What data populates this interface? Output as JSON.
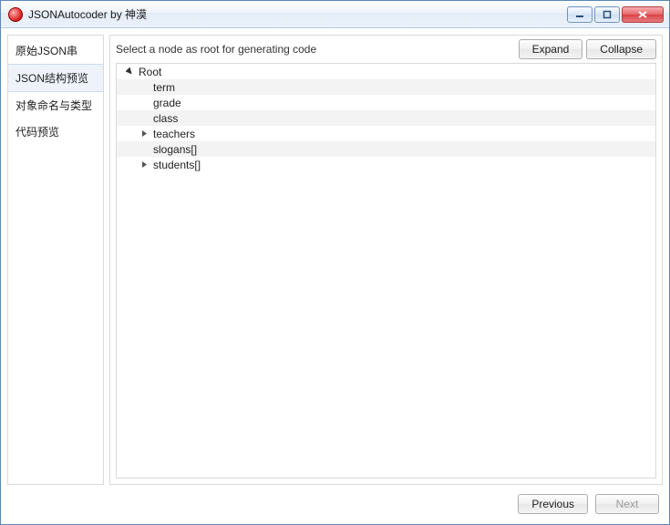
{
  "window": {
    "title": "JSONAutocoder by 神漠"
  },
  "sidebar": {
    "items": [
      {
        "label": "原始JSON串",
        "selected": false
      },
      {
        "label": "JSON结构预览",
        "selected": true
      },
      {
        "label": "对象命名与类型",
        "selected": false
      },
      {
        "label": "代码预览",
        "selected": false
      }
    ]
  },
  "header": {
    "hint": "Select a node as root for generating code",
    "expand_label": "Expand",
    "collapse_label": "Collapse"
  },
  "tree": {
    "rows": [
      {
        "label": "Root",
        "depth": 0,
        "toggle": "open",
        "alt": false
      },
      {
        "label": "term",
        "depth": 1,
        "toggle": "none",
        "alt": true
      },
      {
        "label": "grade",
        "depth": 1,
        "toggle": "none",
        "alt": false
      },
      {
        "label": "class",
        "depth": 1,
        "toggle": "none",
        "alt": true
      },
      {
        "label": "teachers",
        "depth": 1,
        "toggle": "closed",
        "alt": false
      },
      {
        "label": "slogans[]",
        "depth": 1,
        "toggle": "none",
        "alt": true
      },
      {
        "label": "students[]",
        "depth": 1,
        "toggle": "closed",
        "alt": false
      }
    ]
  },
  "footer": {
    "previous_label": "Previous",
    "next_label": "Next",
    "next_enabled": false
  }
}
